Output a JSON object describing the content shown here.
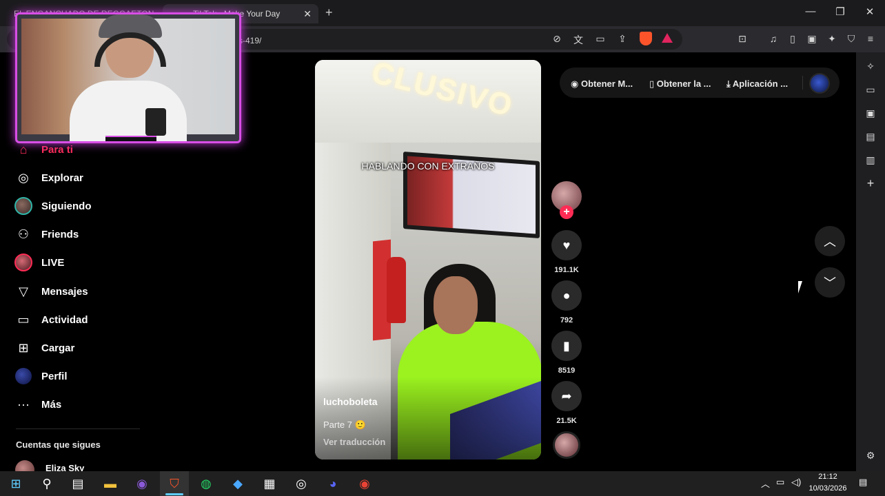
{
  "browser": {
    "tabs": [
      {
        "title": "EL ENGANCHADO DE REGGAETON"
      },
      {
        "title": "TikTok - Make Your Day"
      }
    ],
    "new_tab_symbol": "+",
    "close_symbol": "✕",
    "window_controls": {
      "minimize": "—",
      "maximize": "❐",
      "close": "✕"
    },
    "url": "/es-419/"
  },
  "nav": {
    "items": [
      {
        "label": "Para ti",
        "icon": "home-icon"
      },
      {
        "label": "Explorar",
        "icon": "compass-icon"
      },
      {
        "label": "Siguiendo",
        "icon": "following-avatar"
      },
      {
        "label": "Friends",
        "icon": "friends-icon"
      },
      {
        "label": "LIVE",
        "icon": "live-avatar"
      },
      {
        "label": "Mensajes",
        "icon": "send-icon"
      },
      {
        "label": "Actividad",
        "icon": "activity-icon"
      },
      {
        "label": "Cargar",
        "icon": "upload-icon"
      },
      {
        "label": "Perfil",
        "icon": "profile-avatar"
      },
      {
        "label": "Más",
        "icon": "more-icon"
      }
    ],
    "following_title": "Cuentas que sigues",
    "followed_accounts": [
      {
        "name": "Eliza Sky"
      }
    ]
  },
  "video": {
    "overlay_text": "HABLANDO CON EXTRAÑOS",
    "sign_text": "CLUSIVO",
    "author": "luchoboleta",
    "caption": "Parte 7 🙂",
    "translate_label": "Ver traducción"
  },
  "actions": {
    "likes": "191.1K",
    "comments": "792",
    "saves": "8519",
    "shares": "21.5K",
    "follow_symbol": "+"
  },
  "top_pill": {
    "items": [
      {
        "label": "Obtener M..."
      },
      {
        "label": "Obtener la ..."
      },
      {
        "label": "Aplicación ..."
      }
    ]
  },
  "taskbar": {
    "time": "21:12",
    "date": "10/03/2026"
  },
  "colors": {
    "accent_pink": "#fe2c55",
    "webcam_frame": "#d84ee6",
    "taskbar_active": "#60cdff"
  }
}
